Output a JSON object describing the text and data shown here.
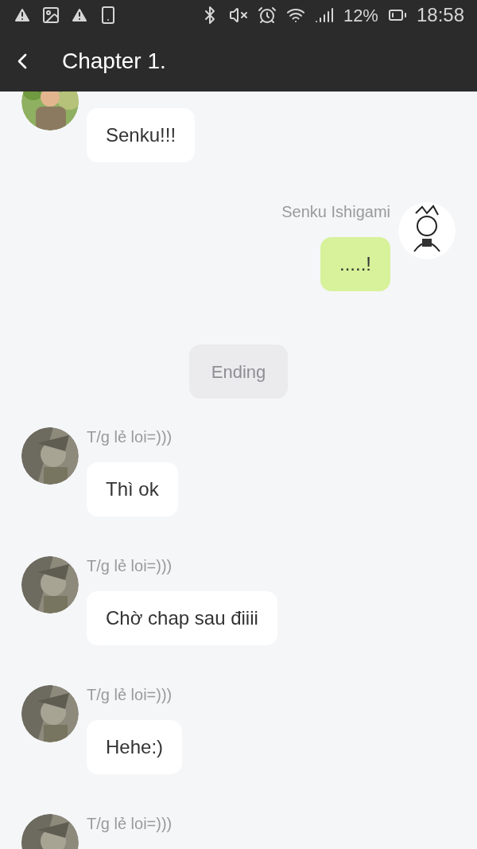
{
  "status_bar": {
    "battery": "12%",
    "time": "18:58"
  },
  "header": {
    "title": "Chapter 1."
  },
  "messages": [
    {
      "kind": "received",
      "text": "Senku!!!"
    },
    {
      "kind": "sent",
      "name": "Senku Ishigami",
      "text": ".....!"
    },
    {
      "kind": "system",
      "text": "Ending"
    },
    {
      "kind": "received",
      "name": "T/g lẻ loi=)))",
      "text": "Thì ok"
    },
    {
      "kind": "received",
      "name": "T/g lẻ loi=)))",
      "text": "Chờ chap sau điiii"
    },
    {
      "kind": "received",
      "name": "T/g lẻ loi=)))",
      "text": "Hehe:)"
    },
    {
      "kind": "received",
      "name": "T/g lẻ loi=)))"
    }
  ]
}
